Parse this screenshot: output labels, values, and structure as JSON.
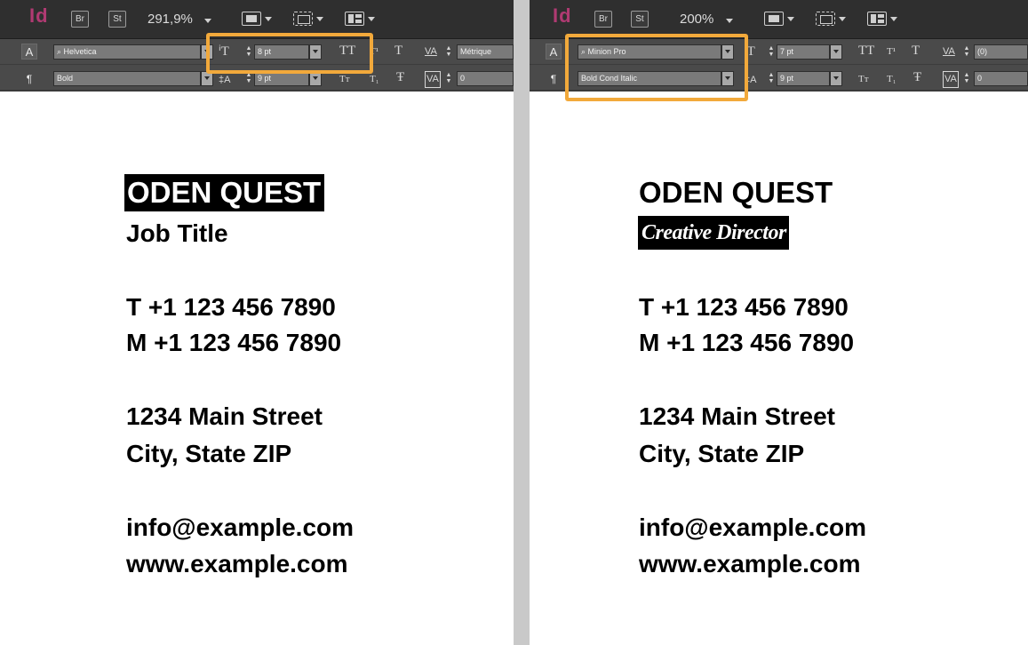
{
  "app": {
    "logo": "Id",
    "bridge_label": "Br",
    "stock_label": "St"
  },
  "left": {
    "zoom": "291,9%",
    "font_family": "Helvetica",
    "font_style": "Bold",
    "font_size": "8 pt",
    "leading": "9 pt",
    "kerning": "Métrique",
    "tracking": "0",
    "card": {
      "name": "ODEN QUEST",
      "title": "Job Title",
      "phone_t": "T  +1 123 456 7890",
      "phone_m": "M +1 123 456 7890",
      "street": "1234 Main Street",
      "city": "City, State ZIP",
      "email": "info@example.com",
      "web": "www.example.com"
    }
  },
  "right": {
    "zoom": "200%",
    "font_family": "Minion Pro",
    "font_style": "Bold Cond Italic",
    "font_size": "7 pt",
    "leading": "9 pt",
    "kerning": "(0)",
    "tracking": "0",
    "card": {
      "name": "ODEN QUEST",
      "title": "Creative Director",
      "phone_t": "T  +1 123 456 7890",
      "phone_m": "M +1 123 456 7890",
      "street": "1234 Main Street",
      "city": "City, State ZIP",
      "email": "info@example.com",
      "web": "www.example.com"
    }
  },
  "glyphs": {
    "all_caps": "TT",
    "superscript": "T¹",
    "underline": "T",
    "small_caps": "Tт",
    "subscript": "T₁",
    "strike": "Ŧ",
    "char_mode": "A",
    "para_mode": "¶",
    "kern_label": "VA",
    "track_label": "VA",
    "size_icon": "ⁱT",
    "leading_icon": "‡A"
  },
  "colors": {
    "highlight": "#f2a93b",
    "logo": "#b03a72",
    "toolbar": "#4a4a4a"
  }
}
